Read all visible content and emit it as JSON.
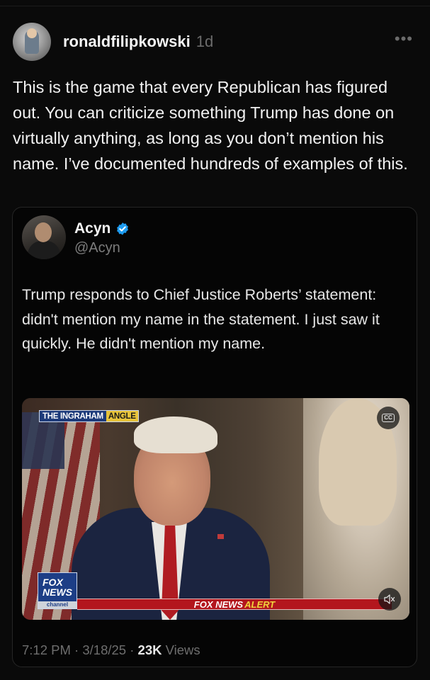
{
  "post": {
    "username": "ronaldfilipkowski",
    "age": "1d",
    "more_label": "•••",
    "text": "This is the game that every Republican has figured out. You can criticize something Trump has done on virtually anything, as long as you don’t mention his name. I’ve documented hundreds of examples of this."
  },
  "quoted_post": {
    "display_name": "Acyn",
    "handle": "@Acyn",
    "verified": true,
    "text": "Trump responds to Chief Justice Roberts’ statement: didn't mention my name in the statement. I just saw it quickly. He didn't mention my name.",
    "video": {
      "show_tag_part1": "THE INGRAHAM",
      "show_tag_part2": "ANGLE",
      "network_logo_line1": "FOX",
      "network_logo_line2": "NEWS",
      "network_logo_sub": "channel",
      "alert_prefix": "FOX NEWS",
      "alert_word": "ALERT",
      "cc_label": "CC"
    },
    "time": "7:12 PM",
    "date": "3/18/25",
    "views_count": "23K",
    "views_label": "Views"
  },
  "icons": {
    "verified": "verified-badge-icon",
    "more": "more-horizontal-icon",
    "cc": "closed-captions-icon",
    "mute": "mute-icon"
  },
  "colors": {
    "background": "#0a0a0a",
    "verified_blue": "#1d9bf0",
    "muted_text": "#6e6e6e",
    "alert_red": "#b3161d",
    "alert_yellow": "#f0d33b",
    "fox_blue": "#1d3e86"
  }
}
